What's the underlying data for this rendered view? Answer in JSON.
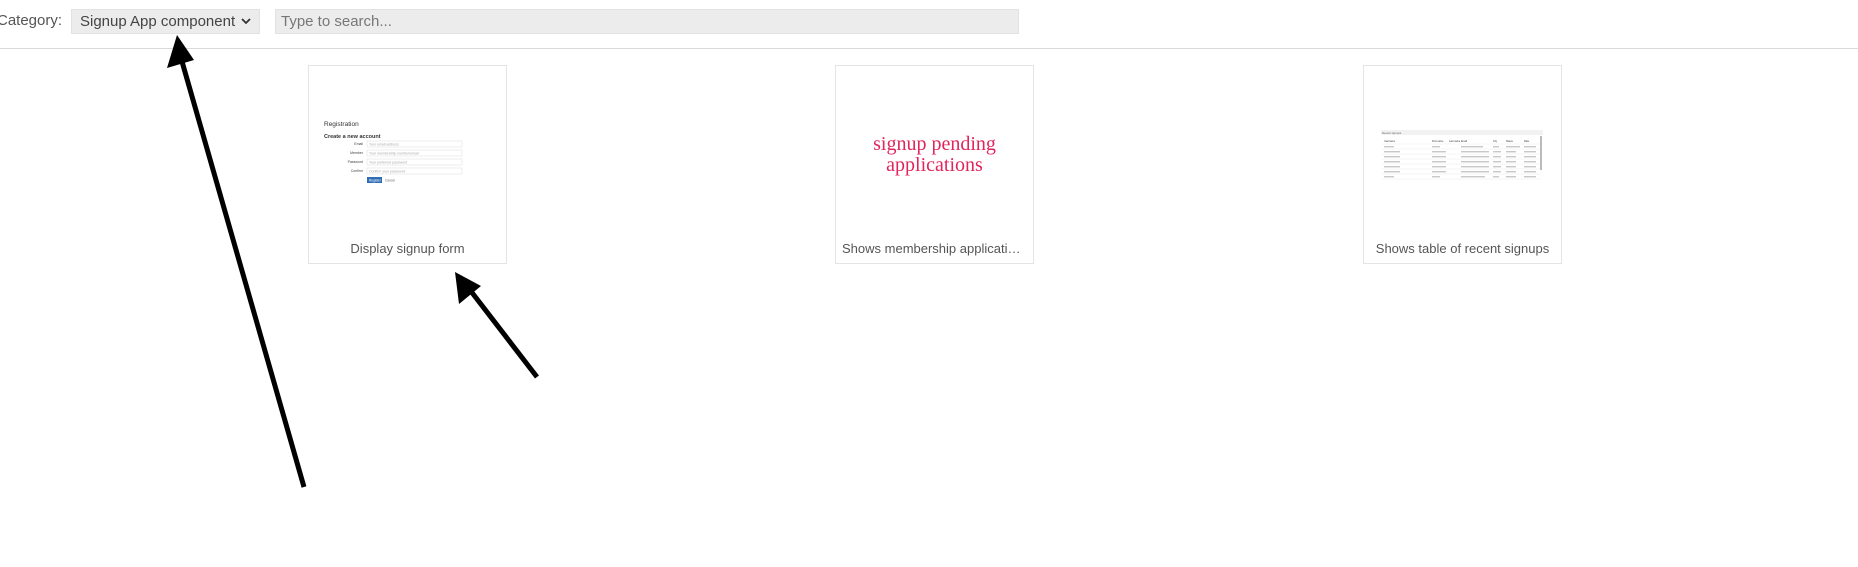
{
  "toolbar": {
    "category_label": "Category:",
    "category_value": "Signup App component",
    "search_placeholder": "Type to search..."
  },
  "cards": [
    {
      "caption": "Display signup form",
      "preview": {
        "title": "Registration",
        "subtitle": "Create a new account",
        "fields": [
          {
            "label": "Email",
            "hint": "Your email address"
          },
          {
            "label": "Member",
            "hint": "Your membership number/email"
          },
          {
            "label": "Password",
            "hint": "Your preferred password"
          },
          {
            "label": "Confirm",
            "hint": "Confirm your password"
          }
        ],
        "submit_label": "Register",
        "cancel_label": "Cancel"
      }
    },
    {
      "caption": "Shows membership applicatio…",
      "preview": {
        "text_line1": "signup pending",
        "text_line2": "applications"
      }
    },
    {
      "caption": "Shows table of recent signups",
      "preview": {
        "header": "Recent signups",
        "columns": [
          "Username",
          "First name",
          "Last name",
          "Email",
          "City",
          "Status",
          "Date"
        ]
      }
    }
  ],
  "colors": {
    "pending_text": "#e0245e",
    "primary_button": "#2f6db5",
    "field_bg": "#ececec"
  }
}
